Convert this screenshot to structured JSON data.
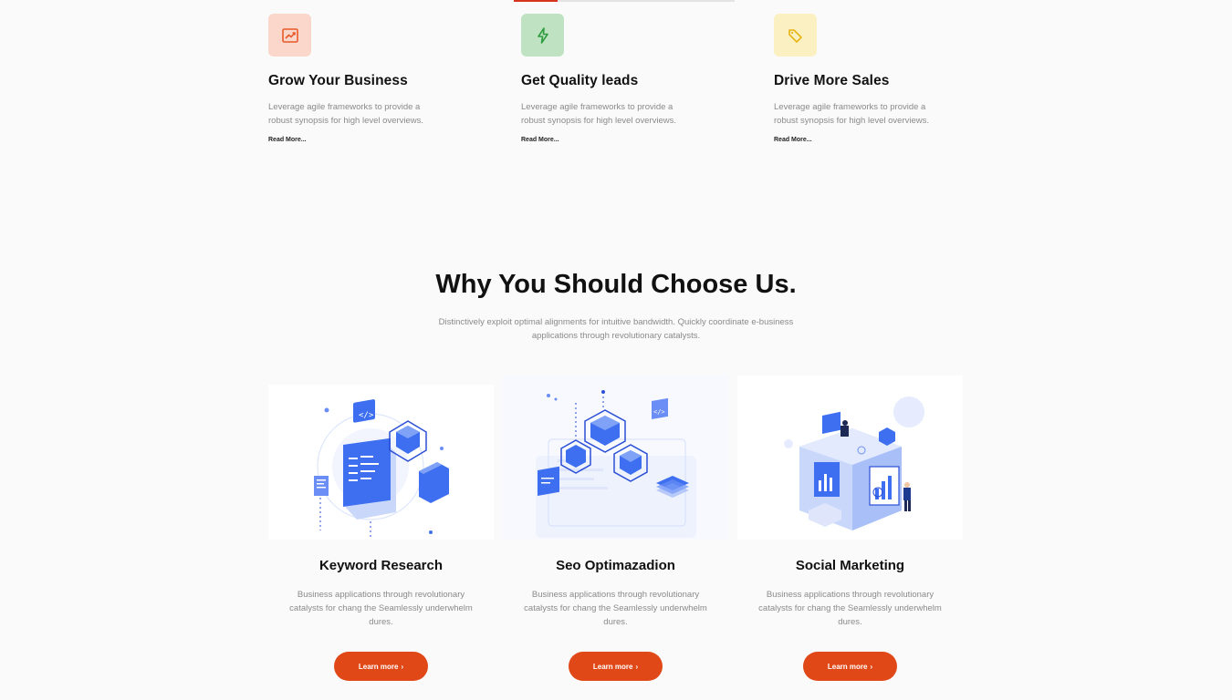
{
  "features": [
    {
      "title": "Grow Your Business",
      "text": "Leverage agile frameworks to provide a robust synopsis for high level overviews.",
      "link": "Read More...",
      "icon": "chart-trend-icon",
      "color": "#e8592b",
      "bg": "#fbd6cb"
    },
    {
      "title": "Get Quality leads",
      "text": "Leverage agile frameworks to provide a robust synopsis for high level overviews.",
      "link": "Read More...",
      "icon": "lightning-icon",
      "color": "#2e9b3f",
      "bg": "#bfe3c2"
    },
    {
      "title": "Drive More Sales",
      "text": "Leverage agile frameworks to provide a robust synopsis for high level overviews.",
      "link": "Read More...",
      "icon": "tag-icon",
      "color": "#e7b416",
      "bg": "#fbf0c2"
    }
  ],
  "section": {
    "title": "Why You Should Choose Us.",
    "subtitle": "Distinctively exploit optimal alignments for intuitive bandwidth. Quickly coordinate e-business applications through revolutionary catalysts."
  },
  "cards": [
    {
      "title": "Keyword Research",
      "text": "Business applications through revolutionary catalysts for chang the Seamlessly underwhelm dures.",
      "button": "Learn more",
      "illustration": "keyword-research-illustration"
    },
    {
      "title": "Seo Optimazadion",
      "text": "Business applications through revolutionary catalysts for chang the Seamlessly underwhelm dures.",
      "button": "Learn more",
      "illustration": "seo-optimization-illustration"
    },
    {
      "title": "Social Marketing",
      "text": "Business applications through revolutionary catalysts for chang the Seamlessly underwhelm dures.",
      "button": "Learn more",
      "illustration": "social-marketing-illustration"
    }
  ],
  "colors": {
    "accent": "#e14818",
    "illustration_blue": "#3d6ff0"
  }
}
